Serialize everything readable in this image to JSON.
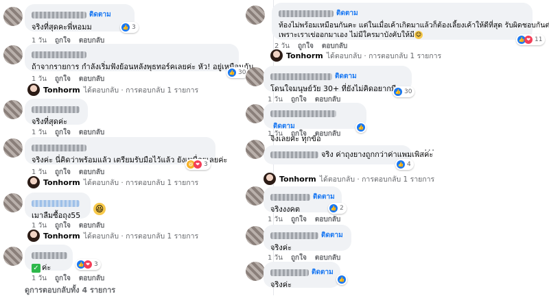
{
  "labels": {
    "follow": "ติดตาม",
    "time": "1 วัน",
    "like": "ถูกใจ",
    "reply": "ตอบกลับ",
    "time2": "2 วัน",
    "replied_by": "Tonhorm",
    "replied_text": "ได้ตอบกลับ · การตอบกลับ 1 รายการ"
  },
  "left": [
    {
      "text": "จริงที่สุดคะพี่หอมม",
      "reactions": "3"
    },
    {
      "text": "ถ้าจากรายการ กำลังเริ่มฟังย้อนหลังพุธทอร์คเลยค่ะ หัว! อยู่เหมือนกัน",
      "reactions": "30"
    },
    {
      "text": "จริงที่สุดค่ะ"
    },
    {
      "text": "จริงค่ะ นี่คิดว่าพร้อมแล้ว เตรียมรับมือไว้แล้ว ยังเหนื่อยเลยค่ะ",
      "reactions": "3"
    },
    {
      "text": "เมาลืมซื้อถุง55"
    },
    {
      "text": "ค่ะ",
      "reactions": "3"
    }
  ],
  "left_more": "ดูการตอบกลับทั้ง 4 รายการ",
  "right": [
    {
      "text1": "ท้องไม่พร้อมเหมือนกันคะ แต่ในเมื่อเค้าเกิดมาแล้วก็ต้องเลี้ยงเค้าให้ดีที่สุด รับผิดชอบกันต่อไปค่ะ",
      "text2": "เพราะเราเข่ออกมาเอง ไม่มีใครมาบังคับให้มี",
      "reactions": "11"
    },
    {
      "text": "โดนใจมนุษย์วัย 30+ ที่ยังไม่คิดอยากมีลูก",
      "reactions": "30"
    },
    {
      "text": "จิงเลยคะ ทุกข้อ"
    },
    {
      "text": "จริง ค่าถุงยางถูกกว่าค่าแพมเพิสค่ะ",
      "reactions": "4"
    },
    {
      "text": "จริงงงคต",
      "reactions": "2"
    },
    {
      "text": "จริงค่ะ"
    },
    {
      "text": "จริงค่ะ"
    }
  ],
  "colors": {
    "link": "#1877f2",
    "like": "#1877f2",
    "love": "#f33e58",
    "bubble": "#f0f2f5"
  }
}
